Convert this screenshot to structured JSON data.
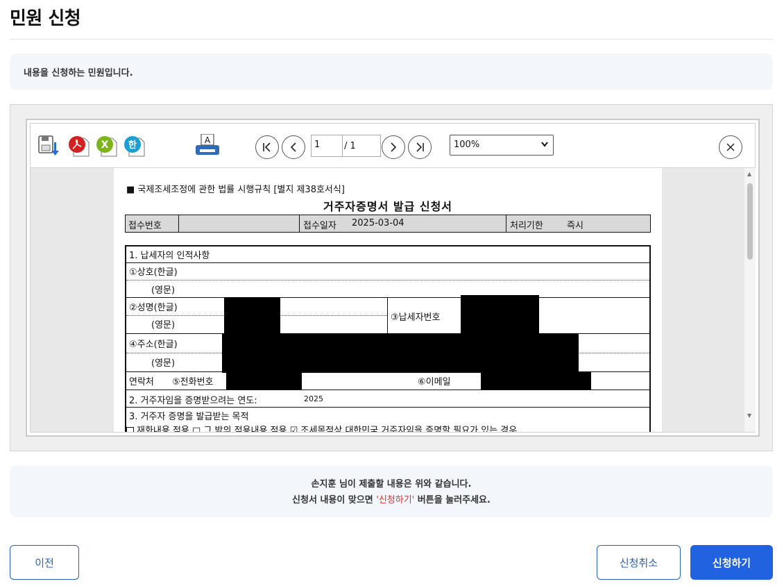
{
  "page": {
    "title": "민원 신청",
    "info_text": "내용을 신청하는 민원입니다."
  },
  "viewer": {
    "current_page": "1",
    "total_pages": "/ 1",
    "zoom": "100%",
    "toolbar_icons": [
      "save-icon",
      "pdf-icon",
      "excel-icon",
      "hwp-icon",
      "print-icon",
      "first-page-icon",
      "prev-page-icon",
      "next-page-icon",
      "last-page-icon",
      "close-icon"
    ]
  },
  "document": {
    "law_ref": "■ 국제조세조정에 관한 법률 시행규칙 [별지 제38호서식]",
    "title": "거주자증명서 발급 신청서",
    "receipt": {
      "no_label": "접수번호",
      "date_label": "접수일자",
      "date_value": "2025-03-04",
      "period_label": "처리기한",
      "period_value": "즉시"
    },
    "section1": "1. 납세자의 인적사항",
    "fields": {
      "company_kr": "①상호(한글)",
      "company_en": "(영문)",
      "name_kr": "②성명(한글)",
      "name_en": "(영문)",
      "taxpayer_no": "③납세자번호",
      "address_kr": "④주소(한글)",
      "address_en": "(영문)",
      "contact": "연락처",
      "phone": "⑤전화번호",
      "email": "⑥이메일"
    },
    "section2": "2. 거주자임을 증명받으려는 연도:",
    "section2_year": "2025",
    "section3": "3. 거주자 증명을 발급받는 목적",
    "purpose_row": "재화내용 적용   □ 그 밖의 적용내용 적용   ☑ 조세목적상 대한민국 거주자임을 증명할 필요가 있는 경우"
  },
  "notice": {
    "line1": "손지훈 님이 제출할 내용은 위와 같습니다.",
    "line2_prefix": "신청서 내용이 맞으면 ",
    "line2_highlight": "'신청하기'",
    "line2_suffix": " 버튼을 눌러주세요."
  },
  "buttons": {
    "prev": "이전",
    "cancel": "신청취소",
    "submit": "신청하기"
  },
  "colors": {
    "primary": "#2162e0",
    "highlight": "#e03030",
    "panel_bg": "#f3f6fb"
  }
}
